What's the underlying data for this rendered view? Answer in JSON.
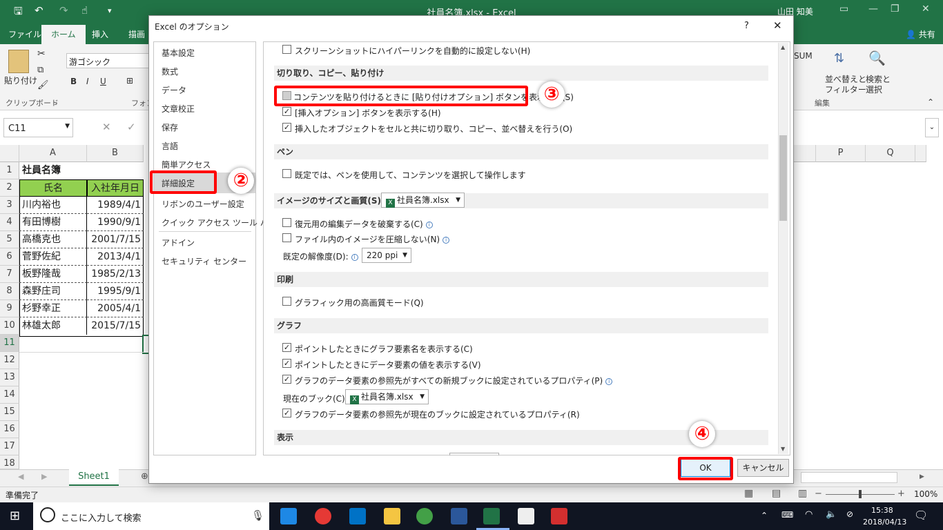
{
  "window": {
    "title": "社員名簿.xlsx  -  Excel",
    "user": "山田 知美",
    "share": "共有"
  },
  "tabs": [
    "ファイル",
    "ホーム",
    "挿入",
    "描画"
  ],
  "ribbon": {
    "paste": "貼り付け",
    "font_name": "游ゴシック",
    "clipboard_label": "クリップボード",
    "font_label": "フォン",
    "sum": "SUM",
    "sort_filter": "並べ替えと",
    "sort_filter2": "フィルター",
    "find_select": "検索と",
    "find_select2": "選択",
    "edit_label": "編集"
  },
  "formula": {
    "namebox": "C11"
  },
  "columns": [
    "A",
    "B",
    "P",
    "Q"
  ],
  "rows": [
    "1",
    "2",
    "3",
    "4",
    "5",
    "6",
    "7",
    "8",
    "9",
    "10",
    "11",
    "12",
    "13",
    "14",
    "15",
    "16",
    "17",
    "18"
  ],
  "sheet": {
    "title": "社員名簿",
    "headers": [
      "氏名",
      "入社年月日"
    ],
    "records": [
      {
        "name": "川内裕也",
        "date": "1989/4/1"
      },
      {
        "name": "有田博樹",
        "date": "1990/9/1"
      },
      {
        "name": "高橋克也",
        "date": "2001/7/15"
      },
      {
        "name": "菅野佐紀",
        "date": "2013/4/1"
      },
      {
        "name": "板野隆哉",
        "date": "1985/2/13"
      },
      {
        "name": "森野庄司",
        "date": "1995/9/1"
      },
      {
        "name": "杉野幸正",
        "date": "2005/4/1"
      },
      {
        "name": "林雄太郎",
        "date": "2015/7/15"
      }
    ],
    "tab": "Sheet1"
  },
  "status": {
    "ready": "準備完了",
    "zoom": "100%"
  },
  "taskbar": {
    "search": "ここに入力して検索",
    "time": "15:38",
    "date": "2018/04/13"
  },
  "dialog": {
    "title": "Excel のオプション",
    "help": "?",
    "close": "✕",
    "nav": [
      "基本設定",
      "数式",
      "データ",
      "文章校正",
      "保存",
      "言語",
      "簡単アクセス",
      "詳細設定",
      "リボンのユーザー設定",
      "クイック アクセス ツール バー",
      "アドイン",
      "セキュリティ センター"
    ],
    "top_option": "スクリーンショットにハイパーリンクを自動的に設定しない(H)",
    "sections": {
      "cut": "切り取り、コピー、貼り付け",
      "pen": "ペン",
      "image": "イメージのサイズと画質(S)",
      "print": "印刷",
      "chart": "グラフ",
      "display": "表示"
    },
    "cut_options": [
      "コンテンツを貼り付けるときに [貼り付けオプション] ボタンを表示する(S)",
      "[挿入オプション] ボタンを表示する(H)",
      "挿入したオブジェクトをセルと共に切り取り、コピー、並べ替えを行う(O)"
    ],
    "pen_option": "既定では、ペンを使用して、コンテンツを選択して操作します",
    "image_file": "社員名簿.xlsx",
    "image_options": [
      "復元用の編集データを破棄する(C)",
      "ファイル内のイメージを圧縮しない(N)"
    ],
    "resolution_label": "既定の解像度(D):",
    "resolution_value": "220 ppi",
    "print_option": "グラフィック用の高画質モード(Q)",
    "chart_options": [
      "ポイントしたときにグラフ要素名を表示する(C)",
      "ポイントしたときにデータ要素の値を表示する(V)",
      "グラフのデータ要素の参照先がすべての新規ブックに設定されているプロパティ(P)"
    ],
    "current_book_label": "現在のブック(C):",
    "current_book": "社員名簿.xlsx",
    "chart_option_last": "グラフのデータ要素の参照先が現在のブックに設定されているプロパティ(R)",
    "ok": "OK",
    "cancel": "キャンセル"
  },
  "markers": [
    "②",
    "③",
    "④"
  ]
}
